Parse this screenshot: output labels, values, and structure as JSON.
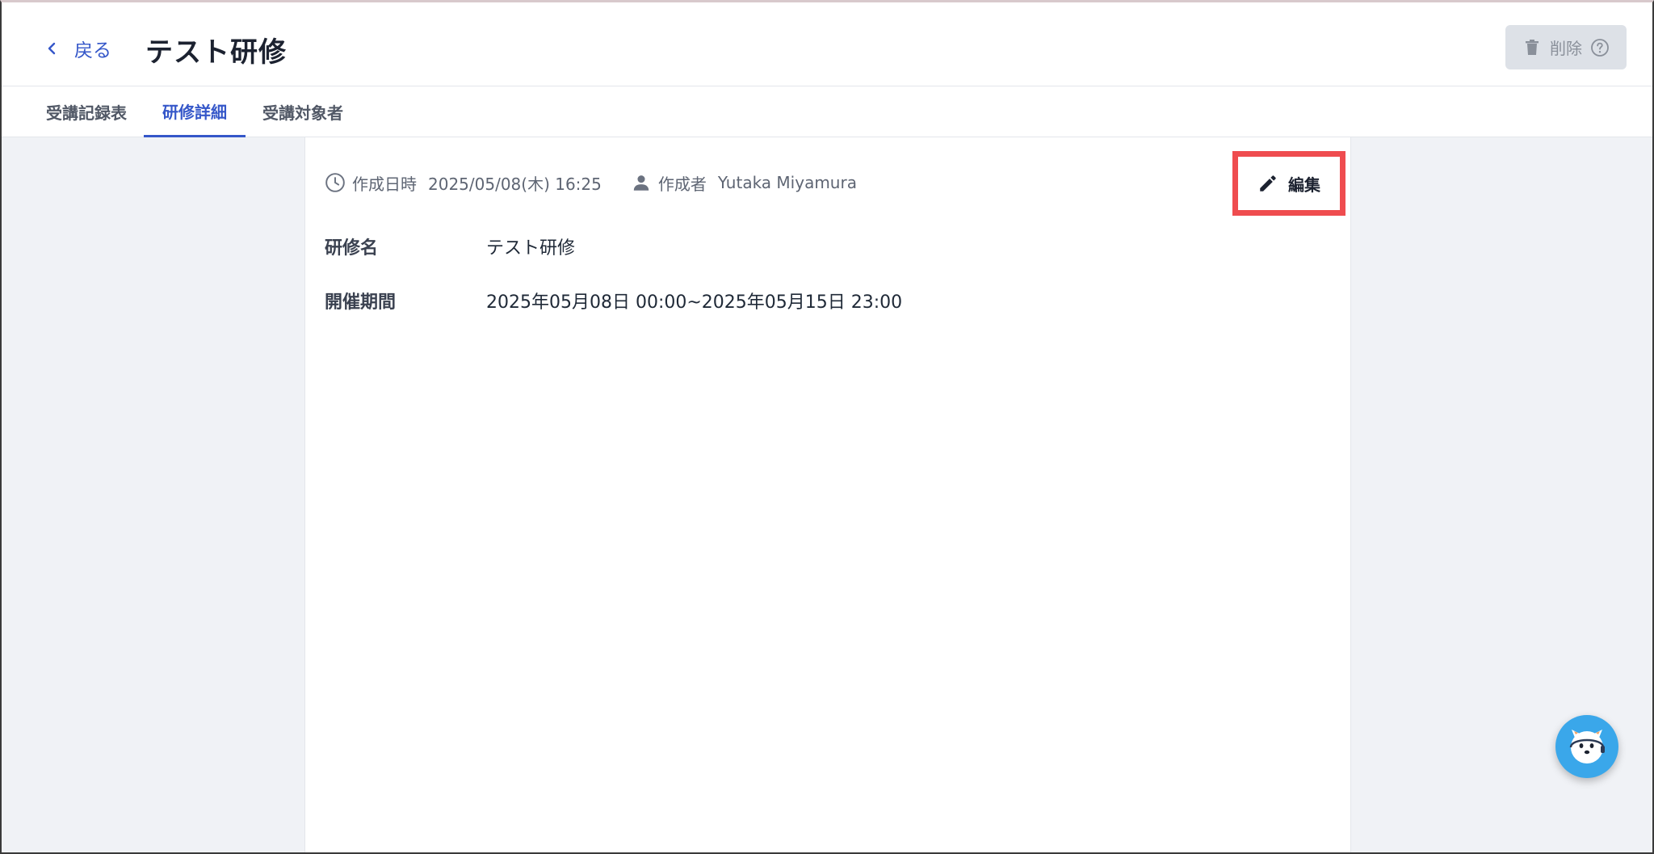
{
  "header": {
    "back_label": "戻る",
    "title": "テスト研修",
    "delete_label": "削除"
  },
  "tabs": [
    {
      "label": "受講記録表"
    },
    {
      "label": "研修詳細"
    },
    {
      "label": "受講対象者"
    }
  ],
  "active_tab": "研修詳細",
  "meta": {
    "created_label": "作成日時",
    "created_value": "2025/05/08(木) 16:25",
    "author_label": "作成者",
    "author_value": "Yutaka Miyamura"
  },
  "edit_label": "編集",
  "fields": [
    {
      "label": "研修名",
      "value": "テスト研修"
    },
    {
      "label": "開催期間",
      "value": "2025年05月08日 00:00~2025年05月15日 23:00"
    }
  ],
  "colors": {
    "accent": "#3557c9",
    "highlight": "#ef4c4f",
    "assistant_bg": "#3aa7ea"
  },
  "icons": {
    "back": "chevron-left-icon",
    "delete": "trash-icon",
    "help": "help-circle-icon",
    "created": "clock-icon",
    "author": "person-icon",
    "edit": "pencil-icon",
    "assistant": "mascot-icon"
  }
}
